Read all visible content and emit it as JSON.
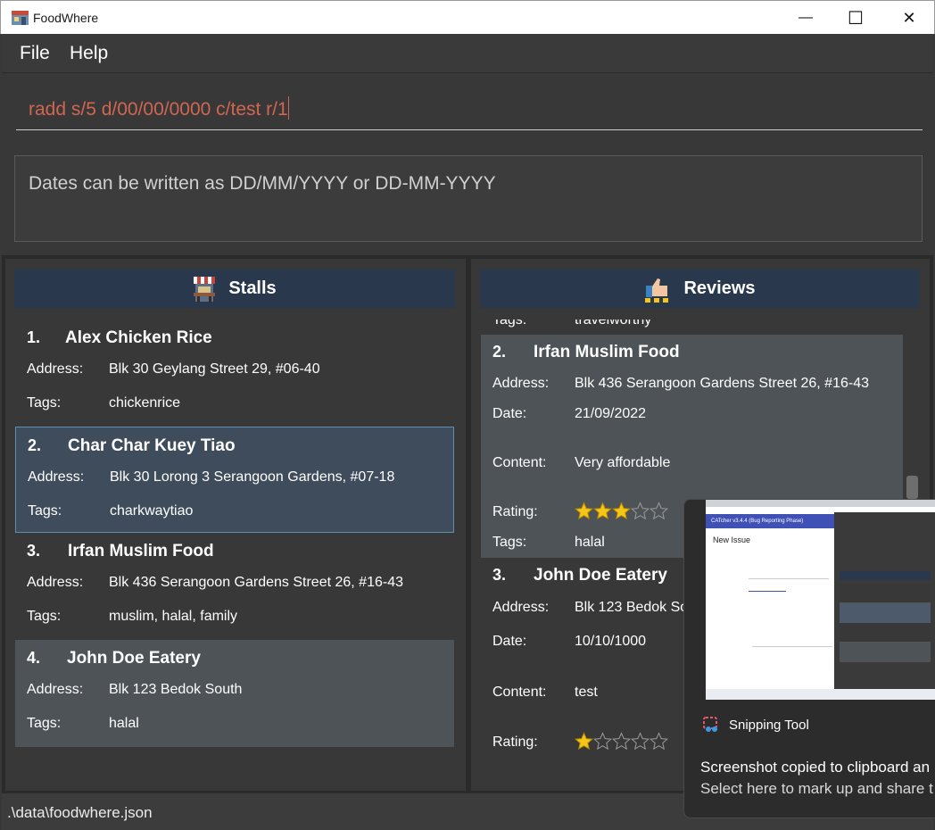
{
  "window": {
    "title": "FoodWhere",
    "minimize_glyph": "—",
    "maximize_glyph": "☐",
    "close_glyph": "✕"
  },
  "menu": {
    "file": "File",
    "help": "Help"
  },
  "command": {
    "value": "radd s/5 d/00/00/0000 c/test r/1"
  },
  "result": {
    "text": "Dates can be written as DD/MM/YYYY or DD-MM-YYYY"
  },
  "stalls": {
    "header": "Stalls",
    "address_label": "Address:",
    "tags_label": "Tags:",
    "items": [
      {
        "num": "1.",
        "name": "Alex Chicken Rice",
        "address": "Blk 30 Geylang Street 29, #06-40",
        "tags": "chickenrice"
      },
      {
        "num": "2.",
        "name": "Char Char Kuey Tiao",
        "address": "Blk 30 Lorong 3 Serangoon Gardens, #07-18",
        "tags": "charkwaytiao"
      },
      {
        "num": "3.",
        "name": "Irfan Muslim Food",
        "address": "Blk 436 Serangoon Gardens Street 26, #16-43",
        "tags": "muslim, halal, family"
      },
      {
        "num": "4.",
        "name": "John Doe Eatery",
        "address": "Blk 123 Bedok South",
        "tags": "halal"
      }
    ]
  },
  "reviews": {
    "header": "Reviews",
    "address_label": "Address:",
    "date_label": "Date:",
    "content_label": "Content:",
    "rating_label": "Rating:",
    "tags_label": "Tags:",
    "partial_tags": "travelworthy",
    "items": [
      {
        "num": "2.",
        "name": "Irfan Muslim Food",
        "address": "Blk 436 Serangoon Gardens Street 26, #16-43",
        "date": "21/09/2022",
        "content": "Very affordable",
        "rating": 3,
        "tags": "halal"
      },
      {
        "num": "3.",
        "name": "John Doe Eatery",
        "address": "Blk 123 Bedok So",
        "date": "10/10/1000",
        "content": "test",
        "rating": 1
      }
    ]
  },
  "status": {
    "path": ".\\data\\foodwhere.json"
  },
  "toast": {
    "app_name": "Snipping Tool",
    "line1": "Screenshot copied to clipboard an",
    "line2": "Select here to mark up and share t",
    "thumb_title": "CATcher v3.4.4 (Bug Reporting Phase)",
    "thumb_heading": "New Issue"
  },
  "colors": {
    "panel_header": "#29384d",
    "selected_border": "#5d8fb2",
    "command_text": "#d06651",
    "star_fill": "#f5c518"
  },
  "icons": [
    "food-stall-icon",
    "review-thumbs-up-icon",
    "star-icon",
    "snipping-tool-icon",
    "foodwhere-app-icon"
  ]
}
